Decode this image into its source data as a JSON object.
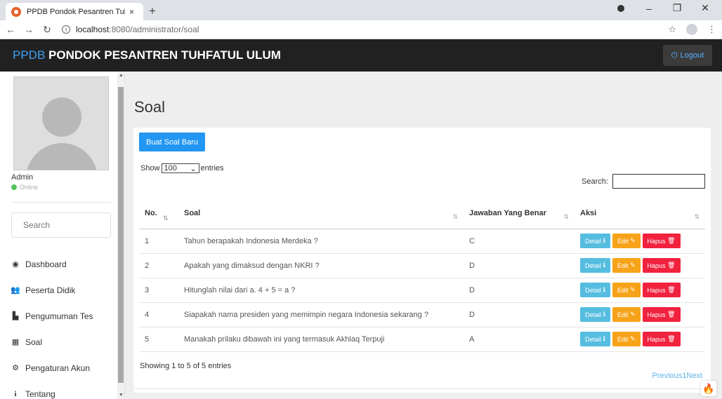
{
  "browser": {
    "tab_title": "PPDB Pondok Pesantren Tuhfatul",
    "tab_close": "×",
    "new_tab": "+",
    "url_host": "localhost",
    "url_path": ":8080/administrator/soal"
  },
  "navbar": {
    "brand_accent": "PPDB",
    "brand_rest": " PONDOK PESANTREN TUHFATUL ULUM",
    "logout_label": "Logout"
  },
  "sidebar": {
    "user_name": "Admin",
    "user_status": "Online",
    "search_placeholder": "Search",
    "items": [
      {
        "label": "Dashboard",
        "icon": "dashboard-icon"
      },
      {
        "label": "Peserta Didik",
        "icon": "users-icon"
      },
      {
        "label": "Pengumuman Tes",
        "icon": "announcement-icon"
      },
      {
        "label": "Soal",
        "icon": "questions-icon"
      },
      {
        "label": "Pengaturan Akun",
        "icon": "settings-icon"
      },
      {
        "label": "Tentang",
        "icon": "info-icon"
      }
    ]
  },
  "main": {
    "page_title": "Soal",
    "create_button": "Buat Soal Baru",
    "show_label": "Show",
    "show_value": "100",
    "entries_label": "entries",
    "search_label": "Search:",
    "columns": [
      "No.",
      "Soal",
      "Jawaban Yang Benar",
      "Aksi"
    ],
    "rows": [
      {
        "no": "1",
        "soal": "Tahun berapakah Indonesia Merdeka ?",
        "jawaban": "C"
      },
      {
        "no": "2",
        "soal": "Apakah yang dimaksud dengan NKRI ?",
        "jawaban": "D"
      },
      {
        "no": "3",
        "soal": "Hitunglah nilai dari a. 4 + 5 = a ?",
        "jawaban": "D"
      },
      {
        "no": "4",
        "soal": "Siapakah nama presiden yang memimpin negara Indonesia sekarang ?",
        "jawaban": "D"
      },
      {
        "no": "5",
        "soal": "Manakah prilaku dibawah ini yang termasuk Akhlaq Terpuji",
        "jawaban": "A"
      }
    ],
    "action_detail": "Detail",
    "action_edit": "Edit",
    "action_hapus": "Hapus",
    "info": "Showing 1 to 5 of 5 entries",
    "pager_previous": "Previous",
    "pager_page": "1",
    "pager_next": "Next"
  },
  "colors": {
    "navbar_bg": "#212121",
    "brand_accent": "#3ea0f2",
    "primary": "#2196f3",
    "detail": "#55bde0",
    "edit": "#f7a31a",
    "hapus": "#f1223e"
  }
}
